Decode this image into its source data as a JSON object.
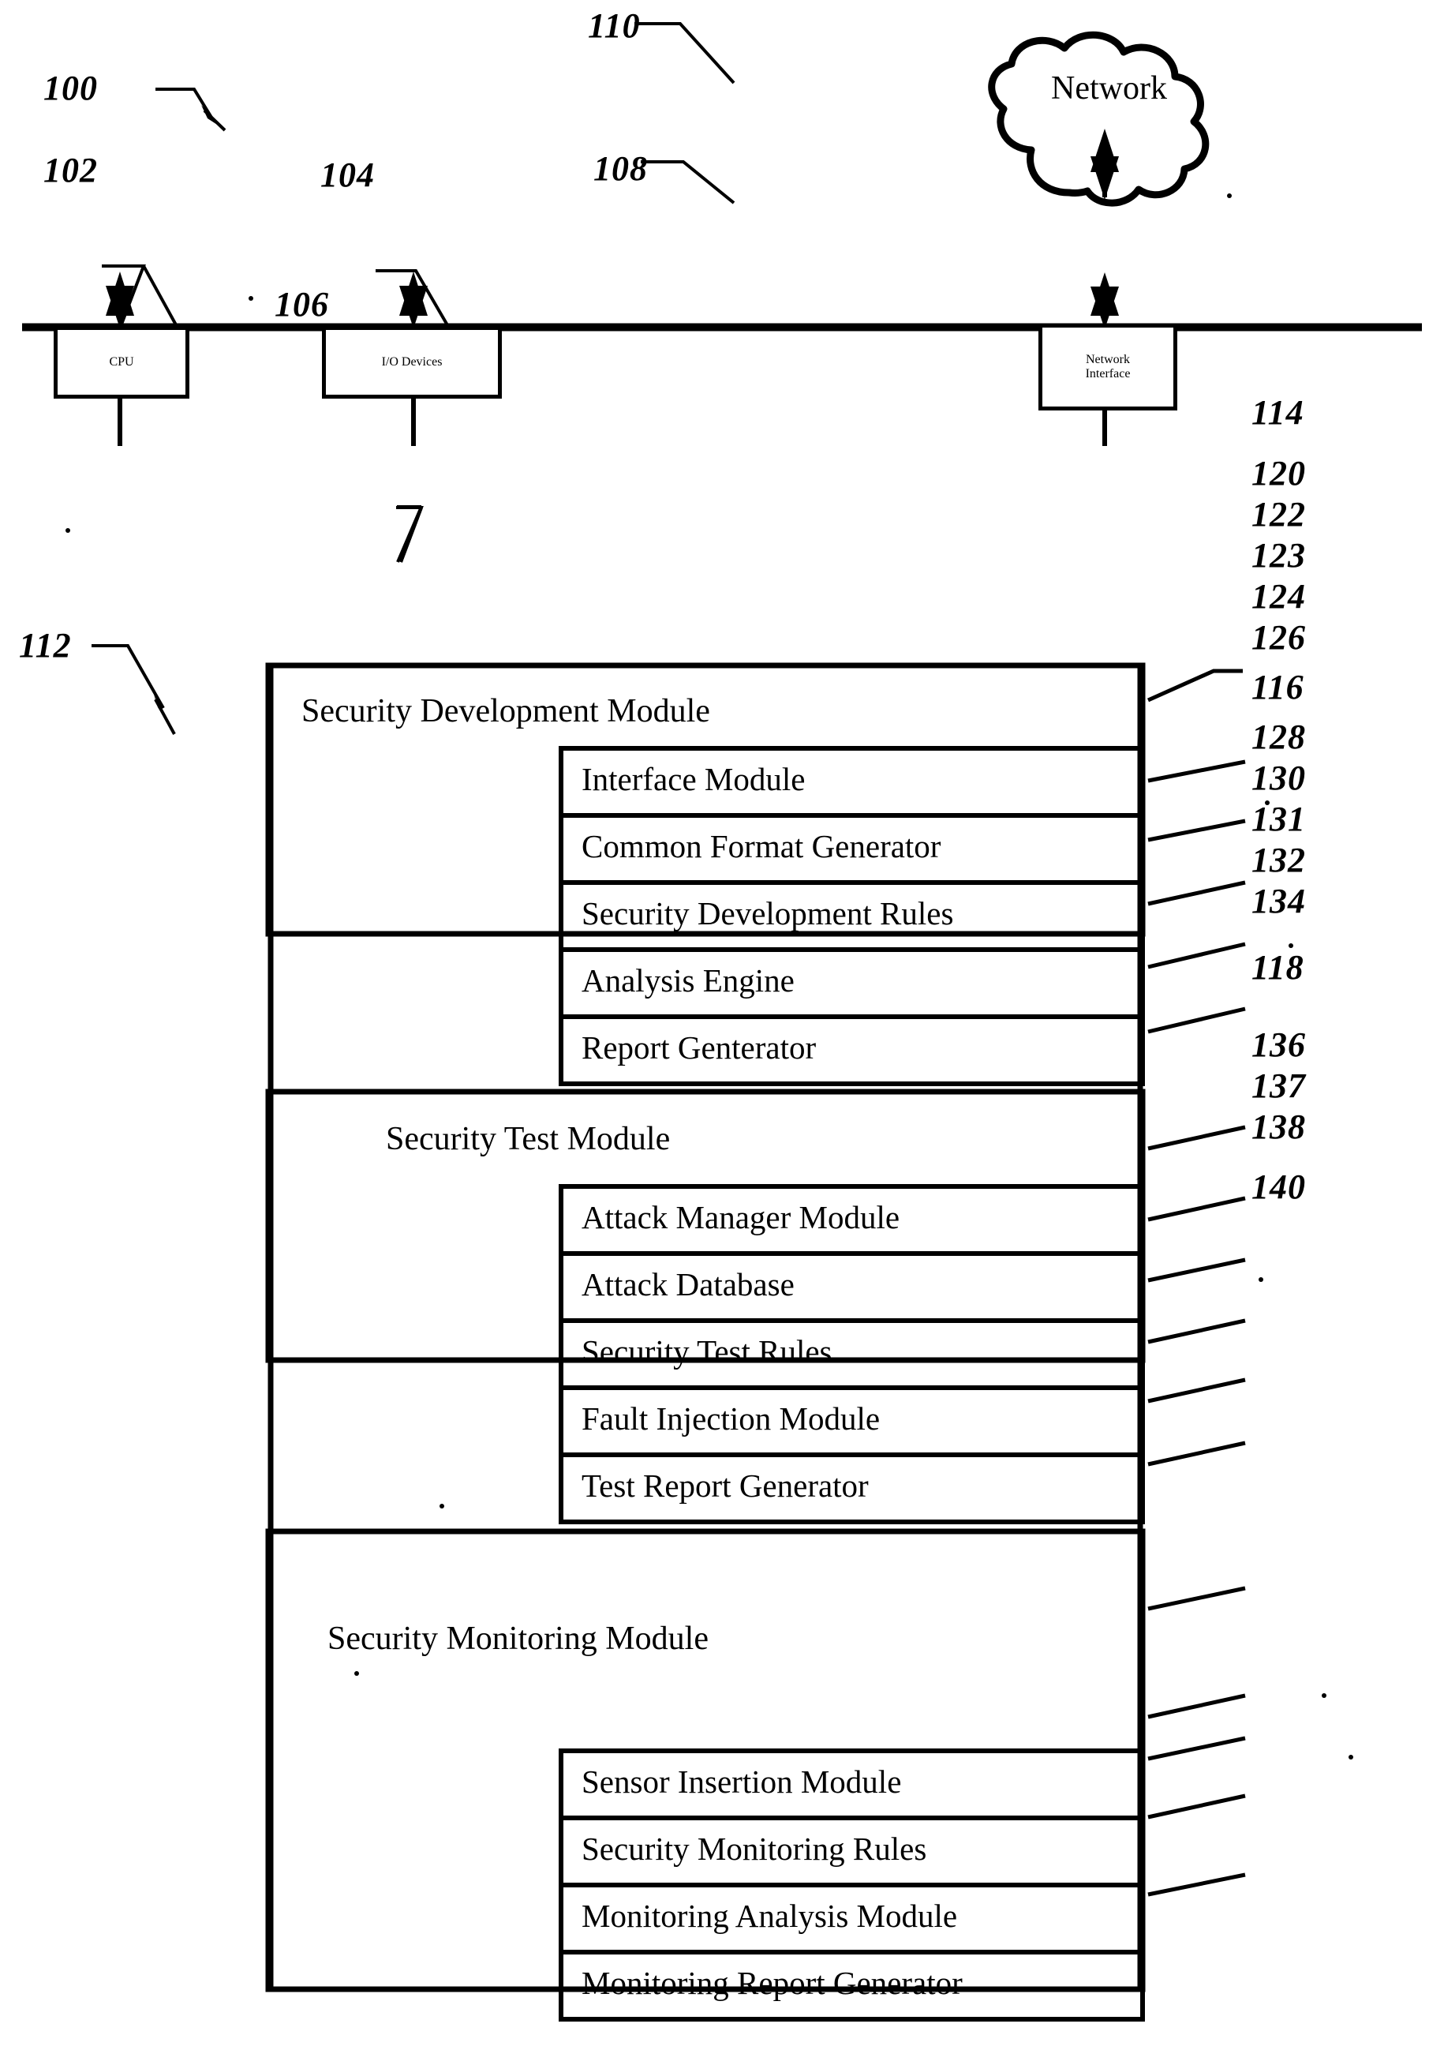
{
  "figure": {
    "type": "patent-block-diagram",
    "system_ref": "100",
    "subsystem_ref": "112"
  },
  "hardware": {
    "cpu": {
      "label": "CPU",
      "ref": "102"
    },
    "io": {
      "label": "I/O Devices",
      "ref": "104"
    },
    "bus": {
      "ref": "106"
    },
    "network_interface": {
      "label_line1": "Network",
      "label_line2": "Interface",
      "ref": "108"
    },
    "network_cloud": {
      "label": "Network",
      "ref": "110"
    }
  },
  "modules": [
    {
      "title": "Security Development Module",
      "ref": "114",
      "submodules": [
        {
          "label": "Interface Module",
          "ref": "120"
        },
        {
          "label": "Common Format Generator",
          "ref": "122"
        },
        {
          "label": "Security Development Rules",
          "ref": "123"
        },
        {
          "label": "Analysis Engine",
          "ref": "124"
        },
        {
          "label": "Report Genterator",
          "ref": "126"
        }
      ]
    },
    {
      "title": "Security Test Module",
      "ref": "116",
      "submodules": [
        {
          "label": "Attack Manager Module",
          "ref": "128"
        },
        {
          "label": "Attack Database",
          "ref": "130"
        },
        {
          "label": "Security Test Rules",
          "ref": "131"
        },
        {
          "label": "Fault Injection Module",
          "ref": "132"
        },
        {
          "label": "Test Report Generator",
          "ref": "134"
        }
      ]
    },
    {
      "title": "Security Monitoring Module",
      "ref": "118",
      "submodules": [
        {
          "label": "Sensor Insertion Module",
          "ref": "136"
        },
        {
          "label": "Security Monitoring Rules",
          "ref": "137"
        },
        {
          "label": "Monitoring Analysis Module",
          "ref": "138"
        },
        {
          "label": "Monitoring Report Generator",
          "ref": "140"
        }
      ]
    }
  ],
  "colors": {
    "ink": "#000000",
    "paper": "#ffffff"
  }
}
